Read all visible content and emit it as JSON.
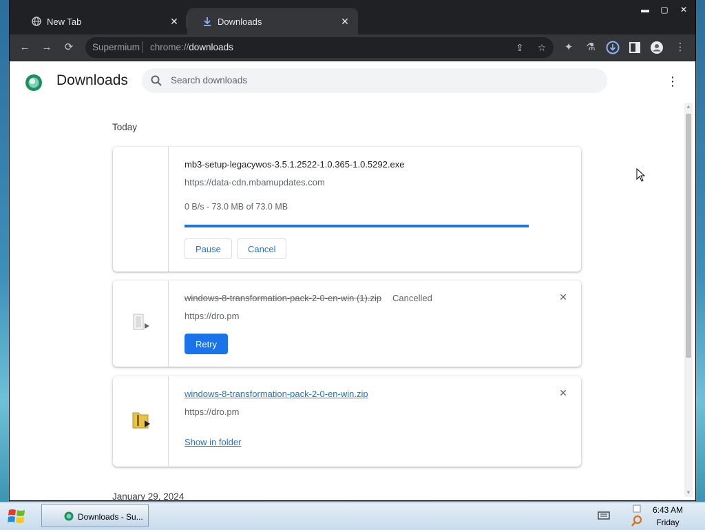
{
  "tabs": [
    {
      "label": "New Tab",
      "icon": "globe-icon",
      "active": false
    },
    {
      "label": "Downloads",
      "icon": "download-icon",
      "active": true
    }
  ],
  "window_controls": {
    "minimize": "▬",
    "maximize": "▢",
    "close": "✕"
  },
  "toolbar": {
    "url_brand": "Supermium",
    "url_scheme": "chrome://",
    "url_path": "downloads",
    "icons": [
      "back-icon",
      "forward-icon",
      "reload-icon",
      "share-icon",
      "star-icon",
      "extensions-icon",
      "labs-icon",
      "download-status-icon",
      "side-panel-icon",
      "profile-icon",
      "menu-icon"
    ]
  },
  "page": {
    "title": "Downloads",
    "search_placeholder": "Search downloads"
  },
  "sections": [
    {
      "date": "Today",
      "items": [
        {
          "filename": "mb3-setup-legacywos-3.5.1.2522-1.0.365-1.0.5292.exe",
          "url": "https://data-cdn.mbamupdates.com",
          "progress_text": "0 B/s - 73.0 MB of 73.0 MB",
          "progress_fraction": 1.0,
          "buttons": [
            "Pause",
            "Cancel"
          ]
        },
        {
          "filename": "windows-8-transformation-pack-2-0-en-win (1).zip",
          "status": "Cancelled",
          "url": "https://dro.pm",
          "buttons": [
            "Retry"
          ]
        },
        {
          "filename": "windows-8-transformation-pack-2-0-en-win.zip",
          "url": "https://dro.pm",
          "link": "Show in folder"
        }
      ]
    },
    {
      "date": "January 29, 2024",
      "items": []
    }
  ],
  "taskbar": {
    "task_label": "Downloads - Su...",
    "time": "6:43 AM",
    "day": "Friday"
  },
  "colors": {
    "accent": "#1a73e8",
    "titlebar": "#202124",
    "toolbar": "#35363a"
  }
}
